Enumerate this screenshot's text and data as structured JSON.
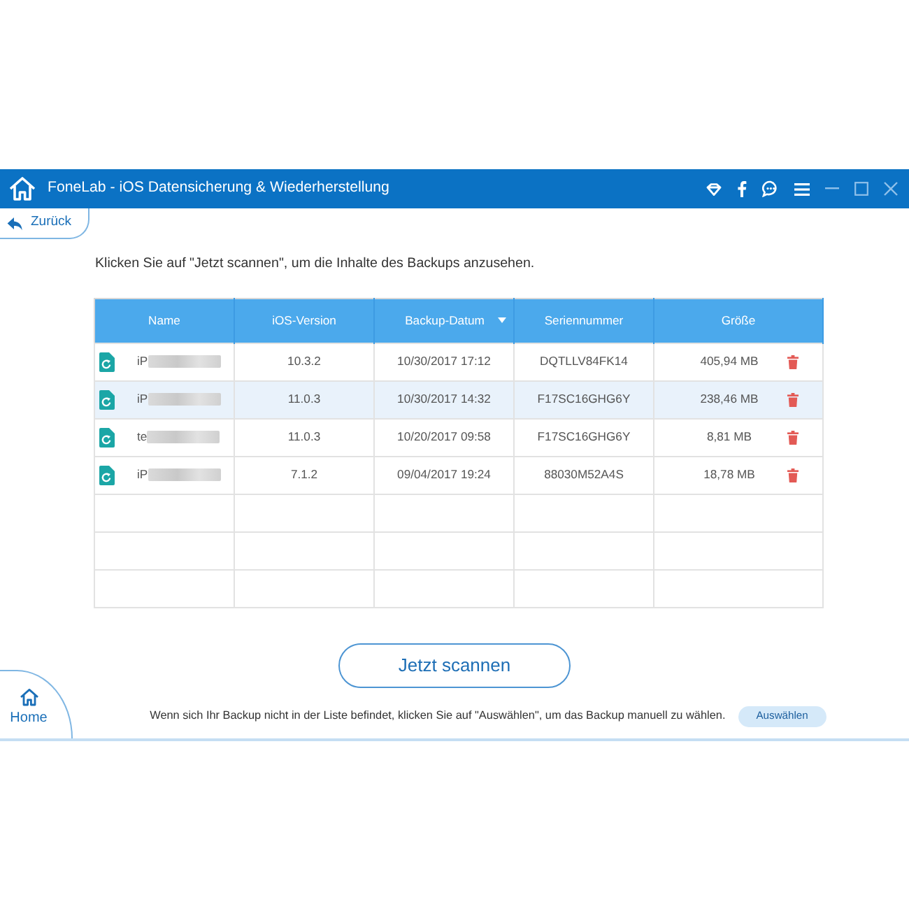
{
  "window": {
    "title": "FoneLab - iOS Datensicherung & Wiederherstellung"
  },
  "back_button": {
    "label": "Zurück"
  },
  "instruction": "Klicken Sie auf \"Jetzt scannen\", um die Inhalte des Backups anzusehen.",
  "table": {
    "columns": [
      {
        "label": "Name",
        "sorted": false
      },
      {
        "label": "iOS-Version",
        "sorted": false
      },
      {
        "label": "Backup-Datum",
        "sorted": true
      },
      {
        "label": "Seriennummer",
        "sorted": false
      },
      {
        "label": "Größe",
        "sorted": false
      }
    ],
    "rows": [
      {
        "name": "iP",
        "redacted": true,
        "ios_version": "10.3.2",
        "backup_date": "10/30/2017 17:12",
        "serial_number": "DQTLLV84FK14",
        "size": "405,94 MB",
        "selected": false
      },
      {
        "name": "iP",
        "redacted": true,
        "ios_version": "11.0.3",
        "backup_date": "10/30/2017 14:32",
        "serial_number": "F17SC16GHG6Y",
        "size": "238,46 MB",
        "selected": true
      },
      {
        "name": "te",
        "redacted": true,
        "ios_version": "11.0.3",
        "backup_date": "10/20/2017 09:58",
        "serial_number": "F17SC16GHG6Y",
        "size": "8,81 MB",
        "selected": false
      },
      {
        "name": "iP",
        "redacted": true,
        "ios_version": "7.1.2",
        "backup_date": "09/04/2017 19:24",
        "serial_number": "88030M52A4S",
        "size": "18,78 MB",
        "selected": false
      }
    ]
  },
  "scan_button": {
    "label": "Jetzt scannen"
  },
  "footer": {
    "hint": "Wenn sich Ihr Backup nicht in der Liste befindet, klicken Sie auf \"Auswählen\", um das Backup manuell zu wählen.",
    "button": "Auswählen"
  },
  "home_button": {
    "label": "Home"
  }
}
